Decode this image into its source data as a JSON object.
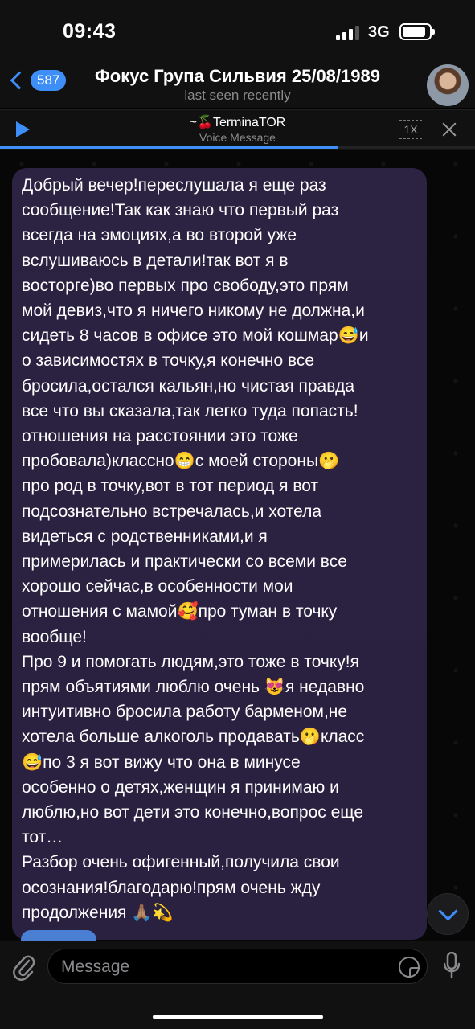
{
  "status_bar": {
    "time": "09:43",
    "network": "3G",
    "signal_bars_active": 3,
    "signal_bars_total": 4
  },
  "header": {
    "back_badge": "587",
    "title": "Фокус Група Сильвия 25/08/1989",
    "subtitle": "last seen recently"
  },
  "player": {
    "title": "~🍒TerminaTOR",
    "subtitle": "Voice Message",
    "speed": "1X",
    "progress": 0.71
  },
  "message": {
    "text": "Добрый вечер!переслушала я еще раз\nсообщение!Так как знаю что первый раз\nвсегда на эмоциях,а во второй уже\nвслушиваюсь в детали!так вот я в\nвосторге)во первых про свободу,это прям\nмой девиз,что я ничего никому не должна,и\nсидеть 8 часов в офисе это мой кошмар😅и\nо зависимостях в точку,я конечно все\nбросила,остался кальян,но чистая правда\nвсе что вы сказала,так легко туда попасть!\nотношения на расстоянии это тоже\nпробовала)классно😁с моей стороны🫢\nпро род в точку,вот в тот период я вот\nподсознательно встречалась,и хотела\nвидеться с родственниками,и я\nпримерилась и практически со всеми все\nхорошо сейчас,в особенности мои\nотношения с мамой🥰про туман в точку\nвообще!\nПро 9 и помогать людям,это тоже в точку!я\nпрям объятиями люблю очень 😻я недавно\nинтуитивно бросила работу барменом,не\nхотела больше алкоголь продавать🫢класс\n😅по 3 я вот вижу что она в минусе\nособенно о детях,женщин я принимаю и\nлюблю,но вот дети это конечно,вопрос еще\nтот…\nРазбор очень офигенный,получила свои\nосознания!благодарю!прям очень жду\nпродолжения 🙏🏽💫"
  },
  "input": {
    "placeholder": "Message"
  },
  "colors": {
    "accent": "#3e8ef7",
    "bubble": "#2a2240",
    "bar": "#111111"
  },
  "icons": {
    "back": "chevron-left-icon",
    "play": "play-icon",
    "close": "close-icon",
    "attach": "paperclip-icon",
    "sticker": "sticker-icon",
    "mic": "microphone-icon",
    "scroll": "chevron-down-icon"
  }
}
